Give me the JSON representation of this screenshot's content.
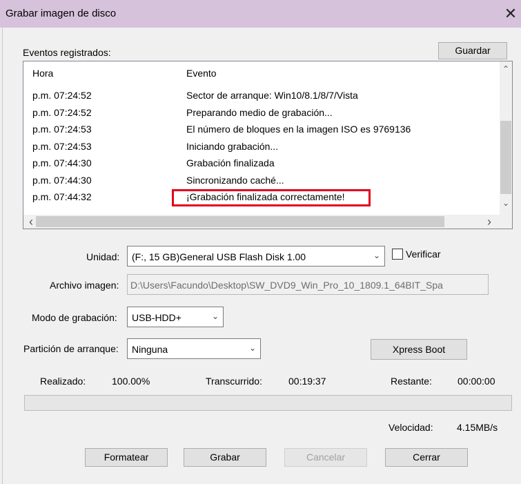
{
  "window": {
    "title": "Grabar imagen de disco",
    "close_glyph": "✕"
  },
  "log": {
    "label": "Eventos registrados:",
    "save_label": "Guardar",
    "columns": {
      "time": "Hora",
      "event": "Evento"
    },
    "rows": [
      {
        "time": "p.m. 07:24:52",
        "event": "Sector de arranque: Win10/8.1/8/7/Vista"
      },
      {
        "time": "p.m. 07:24:52",
        "event": "Preparando medio de grabación..."
      },
      {
        "time": "p.m. 07:24:53",
        "event": "El número de bloques en la imagen ISO es 9769136"
      },
      {
        "time": "p.m. 07:24:53",
        "event": "Iniciando grabación..."
      },
      {
        "time": "p.m. 07:44:30",
        "event": "Grabación finalizada"
      },
      {
        "time": "p.m. 07:44:30",
        "event": "Sincronizando caché..."
      },
      {
        "time": "p.m. 07:44:32",
        "event": "¡Grabación finalizada correctamente!"
      }
    ],
    "highlight_color": "#e3001b"
  },
  "drive": {
    "label": "Unidad:",
    "value": "(F:, 15 GB)General USB Flash Disk  1.00",
    "verify_label": "Verificar",
    "verify_checked": false
  },
  "image_file": {
    "label": "Archivo imagen:",
    "value": "D:\\Users\\Facundo\\Desktop\\SW_DVD9_Win_Pro_10_1809.1_64BIT_Spa"
  },
  "write_mode": {
    "label": "Modo de grabación:",
    "value": "USB-HDD+"
  },
  "boot_partition": {
    "label": "Partición de arranque:",
    "value": "Ninguna",
    "xpress_label": "Xpress Boot"
  },
  "status": {
    "done_label": "Realizado:",
    "done_value": "100.00%",
    "elapsed_label": "Transcurrido:",
    "elapsed_value": "00:19:37",
    "remaining_label": "Restante:",
    "remaining_value": "00:00:00",
    "progress_fraction": 1.0,
    "speed_label": "Velocidad:",
    "speed_value": "4.15MB/s"
  },
  "buttons": {
    "format": "Formatear",
    "burn": "Grabar",
    "cancel": "Cancelar",
    "close": "Cerrar"
  },
  "icons": {
    "scroll_up": "chevron-up-icon",
    "scroll_down": "chevron-down-icon",
    "scroll_left": "chevron-left-icon",
    "scroll_right": "chevron-right-icon",
    "dropdown": "chevron-down-icon"
  },
  "glyphs": {
    "up": "⌃",
    "down": "⌄",
    "left": "‹",
    "right": "›",
    "dropdown": "⌄"
  }
}
